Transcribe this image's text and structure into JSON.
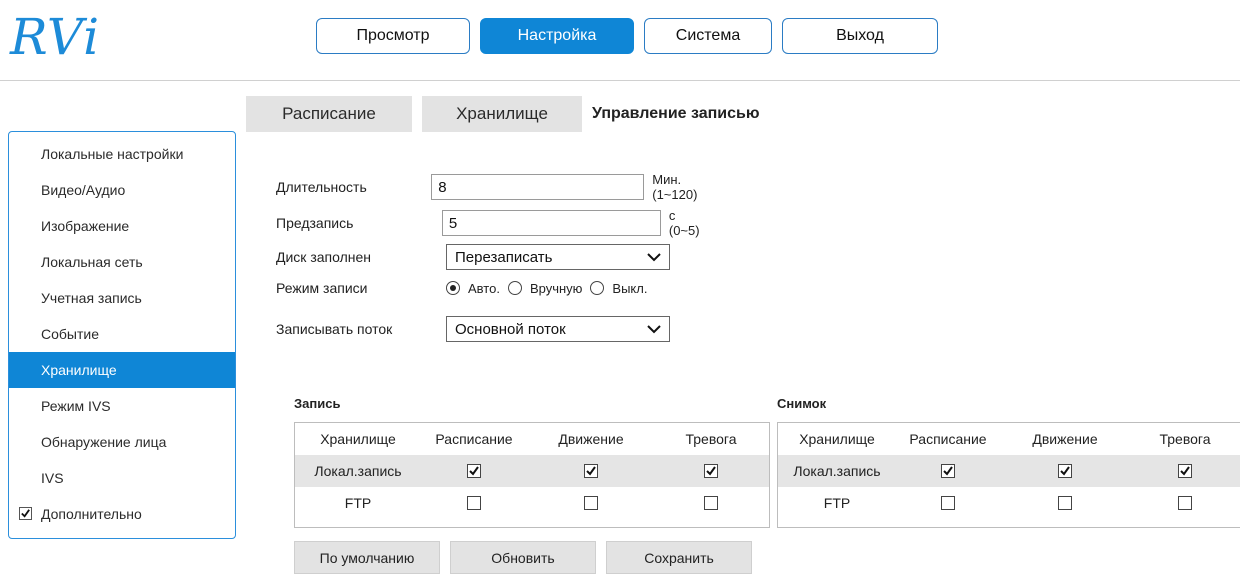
{
  "logo": "RVi",
  "topnav": [
    "Просмотр",
    "Настройка",
    "Система",
    "Выход"
  ],
  "subtabs": [
    "Расписание",
    "Хранилище",
    "Управление записью"
  ],
  "sidebar": {
    "items": [
      "Локальные настройки",
      "Видео/Аудио",
      "Изображение",
      "Локальная сеть",
      "Учетная запись",
      "Событие",
      "Хранилище",
      "Режим IVS",
      "Обнаружение лица",
      "IVS",
      "Дополнительно"
    ],
    "active": "Хранилище"
  },
  "form": {
    "duration": {
      "label": "Длительность",
      "value": "8",
      "hint": "Мин. (1~120)"
    },
    "prerecord": {
      "label": "Предзапись",
      "value": "5",
      "hint": "с (0~5)"
    },
    "disk_full": {
      "label": "Диск заполнен",
      "value": "Перезаписать"
    },
    "record_mode": {
      "label": "Режим записи",
      "options": [
        "Авто.",
        "Вручную",
        "Выкл."
      ],
      "selected": "Авто."
    },
    "stream": {
      "label": "Записывать поток",
      "value": "Основной поток"
    }
  },
  "record_table": {
    "title": "Запись",
    "headers": [
      "Хранилище",
      "Расписание",
      "Движение",
      "Тревога"
    ],
    "rows": [
      {
        "name": "Локал.запись",
        "checks": [
          true,
          true,
          true
        ]
      },
      {
        "name": "FTP",
        "checks": [
          false,
          false,
          false
        ]
      }
    ]
  },
  "snapshot_table": {
    "title": "Снимок",
    "headers": [
      "Хранилище",
      "Расписание",
      "Движение",
      "Тревога"
    ],
    "rows": [
      {
        "name": "Локал.запись",
        "checks": [
          true,
          true,
          true
        ]
      },
      {
        "name": "FTP",
        "checks": [
          false,
          false,
          false
        ]
      }
    ]
  },
  "buttons": [
    "По умолчанию",
    "Обновить",
    "Сохранить"
  ],
  "colors": {
    "accent": "#0f86d6",
    "border": "#2b8fdc",
    "tab_bg": "#e3e3e3",
    "row_shade": "#e5e5e5"
  }
}
